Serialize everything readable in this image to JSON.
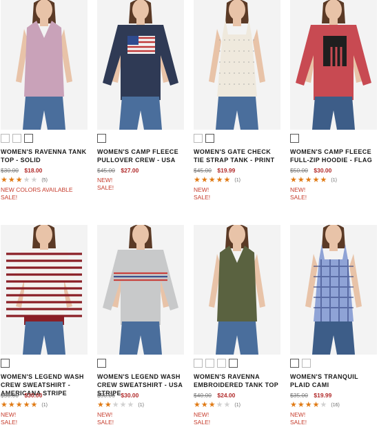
{
  "products": [
    {
      "title": "WOMEN'S RAVENNA TANK TOP - SOLID",
      "was_price": "$30.00",
      "price": "$18.00",
      "rating": 3,
      "review_count": "(5)",
      "flags": [
        "NEW COLORS AVAILABLE",
        "SALE!"
      ],
      "swatches": [
        "#ffffff",
        "#1d2b45",
        "#c49ab4"
      ],
      "selected_swatch": 2,
      "shirt_color": "#c9a2b9",
      "jeans_color": "#4a6e9c"
    },
    {
      "title": "WOMEN'S CAMP FLEECE PULLOVER CREW - USA",
      "was_price": "$45.00",
      "price": "$27.00",
      "rating": 0,
      "review_count": "",
      "flags": [
        "NEW!",
        "SALE!"
      ],
      "swatches": [
        "#33405e"
      ],
      "selected_swatch": 0,
      "shirt_color": "#2f3a55",
      "jeans_color": "#4a6e9c"
    },
    {
      "title": "WOMEN'S GATE CHECK TIE STRAP TANK - PRINT",
      "was_price": "$45.00",
      "price": "$19.99",
      "rating": 5,
      "review_count": "(1)",
      "flags": [
        "NEW!",
        "SALE!"
      ],
      "swatches": [
        "#1a1a1a",
        "#f1ece2"
      ],
      "selected_swatch": 1,
      "shirt_color": "#efe9dd",
      "jeans_color": "#4a6e9c"
    },
    {
      "title": "WOMEN'S CAMP FLEECE FULL-ZIP HOODIE - FLAG",
      "was_price": "$50.00",
      "price": "$30.00",
      "rating": 5,
      "review_count": "(1)",
      "flags": [
        "NEW!",
        "SALE!"
      ],
      "swatches": [
        "#c2484f"
      ],
      "selected_swatch": 0,
      "shirt_color": "#c84a52",
      "jeans_color": "#3d5d88"
    },
    {
      "title": "WOMEN'S LEGEND WASH CREW SWEATSHIRT - AMERICANA STRIPE",
      "was_price": "$50.00",
      "price": "$30.00",
      "rating": 5,
      "review_count": "(1)",
      "flags": [
        "NEW!",
        "SALE!"
      ],
      "swatches": [
        "#7b1d23"
      ],
      "selected_swatch": 0,
      "shirt_color": "#f4f2ee",
      "jeans_color": "#4a6e9c"
    },
    {
      "title": "WOMEN'S LEGEND WASH CREW SWEATSHIRT - USA STRIPE",
      "was_price": "$50.00",
      "price": "$30.00",
      "rating": 2,
      "review_count": "(1)",
      "flags": [
        "NEW!",
        "SALE!"
      ],
      "swatches": [
        "#bdbdbd"
      ],
      "selected_swatch": 0,
      "shirt_color": "#c8c9ca",
      "jeans_color": "#4a6e9c"
    },
    {
      "title": "WOMEN'S RAVENNA EMBROIDERED TANK TOP",
      "was_price": "$40.00",
      "price": "$24.00",
      "rating": 3,
      "review_count": "(1)",
      "flags": [
        "NEW!",
        "SALE!"
      ],
      "swatches": [
        "#2f3a55",
        "#efe8da",
        "#c79bbb",
        "#4d5a34"
      ],
      "selected_swatch": 3,
      "shirt_color": "#5a6240",
      "jeans_color": "#4a6e9c"
    },
    {
      "title": "WOMEN'S TRANQUIL PLAID CAMI",
      "was_price": "$35.00",
      "price": "$19.99",
      "rating": 4,
      "review_count": "(16)",
      "flags": [
        "NEW!",
        "SALE!"
      ],
      "swatches": [
        "#5b73b5",
        "#e07c86"
      ],
      "selected_swatch": 0,
      "shirt_color": "#8fa3d6",
      "jeans_color": "#3d5d88"
    }
  ]
}
